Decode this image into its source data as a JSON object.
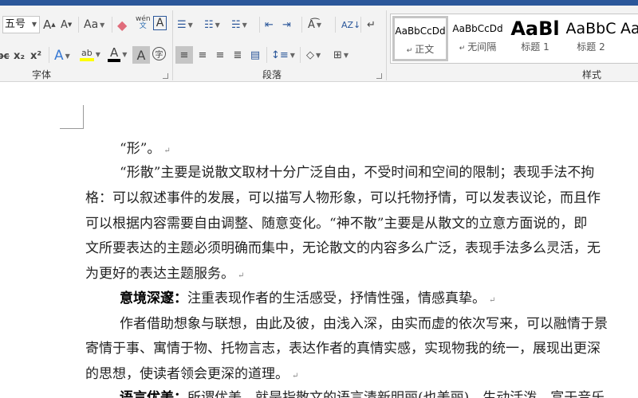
{
  "ribbon": {
    "font_group": {
      "label": "字体",
      "font_size": "五号",
      "grow": "A",
      "shrink": "A",
      "change_case": "Aa",
      "phonetic": "wén",
      "char_border": "A",
      "text_effect": "A",
      "highlight": "ab",
      "font_color": "A",
      "char_shading": "A",
      "enclose": "字",
      "subscript": "x₂",
      "superscript": "x²",
      "strike": "abc"
    },
    "paragraph_group": {
      "label": "段落"
    },
    "styles_group": {
      "label": "样式",
      "items": [
        {
          "preview": "AaBbCcDd",
          "name": "正文"
        },
        {
          "preview": "AaBbCcDd",
          "name": "无间隔"
        },
        {
          "preview": "AaBl",
          "name": "标题 1"
        },
        {
          "preview": "AaBbC",
          "name": "标题 2"
        },
        {
          "preview": "Aa",
          "name": ""
        }
      ]
    }
  },
  "document": {
    "lines": [
      {
        "text": "“形”。",
        "bold": "",
        "indent": true,
        "mark": true
      },
      {
        "text": "“形散”主要是说散文取材十分广泛自由，不受时间和空间的限制；表现手法不拘",
        "bold": "",
        "indent": true,
        "mark": false
      },
      {
        "text": "格：可以叙述事件的发展，可以描写人物形象，可以托物抒情，可以发表议论，而且作",
        "bold": "",
        "indent": false,
        "mark": false
      },
      {
        "text": "可以根据内容需要自由调整、随意变化。“神不散”主要是从散文的立意方面说的，即",
        "bold": "",
        "indent": false,
        "mark": false
      },
      {
        "text": "文所要表达的主题必须明确而集中，无论散文的内容多么广泛，表现手法多么灵活，无",
        "bold": "",
        "indent": false,
        "mark": false
      },
      {
        "text": "为更好的表达主题服务。",
        "bold": "",
        "indent": false,
        "mark": true
      },
      {
        "text": "注重表现作者的生活感受，抒情性强，情感真挚。",
        "bold": "意境深邃：",
        "indent": true,
        "mark": true
      },
      {
        "text": "作者借助想象与联想，由此及彼，由浅入深，由实而虚的依次写来，可以融情于景",
        "bold": "",
        "indent": true,
        "mark": false
      },
      {
        "text": "寄情于事、寓情于物、托物言志，表达作者的真情实感，实现物我的统一，展现出更深",
        "bold": "",
        "indent": false,
        "mark": false
      },
      {
        "text": "的思想，使读者领会更深的道理。",
        "bold": "",
        "indent": false,
        "mark": true
      },
      {
        "text": "所谓优美，就是指散文的语言清新明丽(也美丽)，生动活泼，富于音乐",
        "bold": "语言优美：",
        "indent": true,
        "mark": false
      }
    ],
    "paragraph_mark": "↵"
  }
}
